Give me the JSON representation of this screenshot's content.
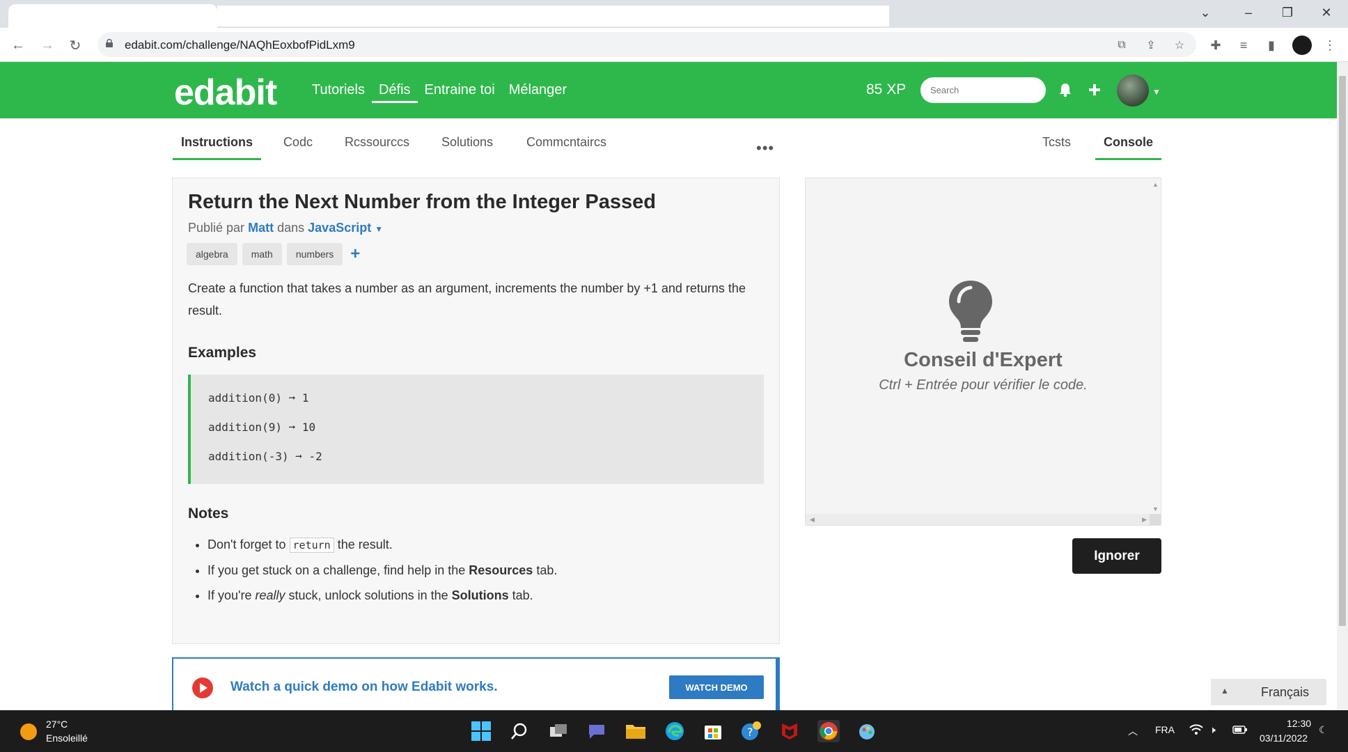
{
  "browser": {
    "url": "edabit.com/challenge/NAQhEoxbofPidLxm9"
  },
  "site": {
    "logo": "edabit",
    "nav": [
      {
        "label": "Tutoriels"
      },
      {
        "label": "Défis"
      },
      {
        "label": "Entraine toi"
      },
      {
        "label": "Mélanger"
      }
    ],
    "xp": "85 XP",
    "search_placeholder": "Search"
  },
  "tabs": {
    "left": [
      {
        "label": "Instructions"
      },
      {
        "label": "Codc"
      },
      {
        "label": "Rcssourccs"
      },
      {
        "label": "Solutions"
      },
      {
        "label": "Commcntaircs"
      }
    ],
    "more": "•••",
    "right": [
      {
        "label": "Tcsts"
      },
      {
        "label": "Console"
      }
    ]
  },
  "challenge": {
    "title": "Return the Next Number from the Integer Passed",
    "published_prefix": "Publié par",
    "author": "Matt",
    "in_word": "dans",
    "language": "JavaScript",
    "tags": [
      "algebra",
      "math",
      "numbers"
    ],
    "description": "Create a function that takes a number as an argument, increments the number by +1 and returns the result.",
    "examples_heading": "Examples",
    "examples": [
      "addition(0) ➞ 1",
      "addition(9) ➞ 10",
      "addition(-3) ➞ -2"
    ],
    "notes_heading": "Notes",
    "notes": {
      "n1_before": "Don't forget to",
      "n1_code": "return",
      "n1_after": "the result.",
      "n2_before": "If you get stuck on a challenge, find help in the",
      "n2_bold": "Resources",
      "n2_after": "tab.",
      "n3_before": "If you're",
      "n3_em": "really",
      "n3_mid": "stuck, unlock solutions in the",
      "n3_bold": "Solutions",
      "n3_after": "tab."
    }
  },
  "demo": {
    "text": "Watch a quick demo on how Edabit works.",
    "button": "WATCH DEMO"
  },
  "console": {
    "tip_title": "Conseil d'Expert",
    "tip_sub": "Ctrl + Entrée pour vérifier le code.",
    "ignore_button": "Ignorer"
  },
  "language_selector": "Français",
  "taskbar": {
    "temperature": "27°C",
    "weather": "Ensoleillé",
    "input_lang": "FRA",
    "time": "12:30",
    "date": "03/11/2022"
  },
  "colors": {
    "brand_green": "#2eb84b",
    "link_blue": "#2e7bc4",
    "dark_button": "#1f1f1f"
  }
}
